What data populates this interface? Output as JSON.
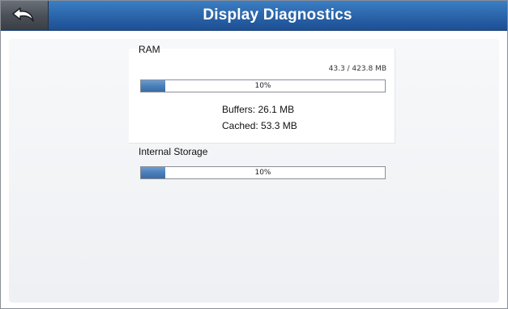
{
  "header": {
    "title": "Display Diagnostics",
    "back_icon": "back-arrow-icon"
  },
  "ram": {
    "label": "RAM",
    "usage": "43.3 / 423.8 MB",
    "percent_text": "10%",
    "percent_value": 0.1,
    "buffers_label": "Buffers:",
    "buffers_value": "26.1 MB",
    "cached_label": "Cached:",
    "cached_value": "53.3 MB"
  },
  "storage": {
    "label": "Internal Storage",
    "percent_text": "10%",
    "percent_value": 0.1
  },
  "colors": {
    "header_blue": "#2a63a8",
    "bar_fill": "#4a7fb9",
    "back_button": "#4c5159"
  }
}
